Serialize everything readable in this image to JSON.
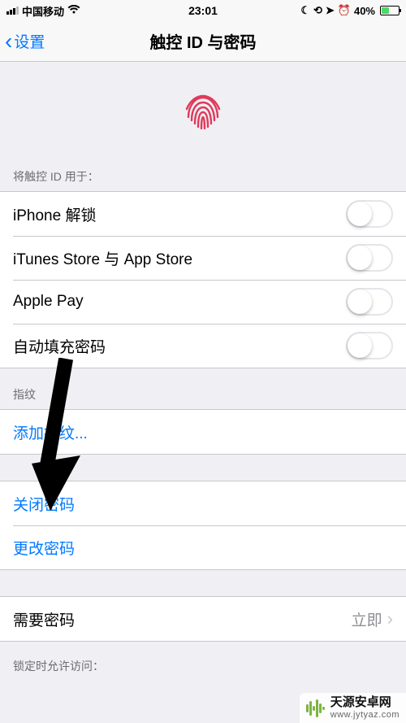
{
  "status": {
    "carrier": "中国移动",
    "time": "23:01",
    "battery_pct": "40%"
  },
  "nav": {
    "back_label": "设置",
    "title": "触控 ID 与密码"
  },
  "sections": {
    "use_for_header": "将触控 ID 用于：",
    "fingerprints_header": "指纹",
    "access_when_locked_header": "锁定时允许访问："
  },
  "toggles": {
    "iphone_unlock": "iPhone 解锁",
    "itunes_appstore": "iTunes Store 与 App Store",
    "apple_pay": "Apple Pay",
    "autofill": "自动填充密码"
  },
  "actions": {
    "add_fingerprint": "添加指纹...",
    "turn_off_passcode": "关闭密码",
    "change_passcode": "更改密码"
  },
  "require_passcode": {
    "label": "需要密码",
    "value": "立即"
  },
  "watermark": {
    "title": "天源安卓网",
    "url": "www.jytyaz.com"
  }
}
